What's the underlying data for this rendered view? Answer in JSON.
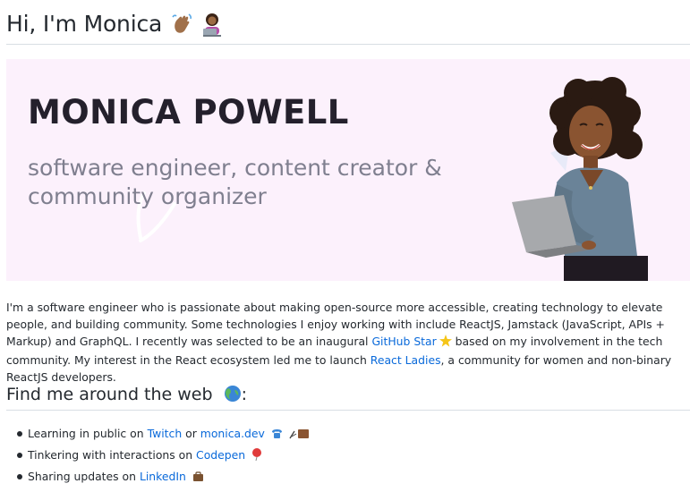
{
  "header": {
    "title": "Hi, I'm Monica",
    "emojis": [
      "waving-hand-icon",
      "technologist-icon"
    ]
  },
  "banner": {
    "name": "MONICA POWELL",
    "tagline": "software engineer, content creator & community organizer",
    "background": "#fcf1fc"
  },
  "intro": {
    "t1": "I'm a software engineer who is passionate about making open-source more accessible, creating technology to elevate people, and building community. Some technologies I enjoy working with include ReactJS, Jamstack (JavaScript, APIs + Markup) and GraphQL. I recently was selected to be an inaugural ",
    "link1": "GitHub Star",
    "t2": " based on my involvement in the tech community. My interest in the React ecosystem led me to launch ",
    "link2": "React Ladies",
    "t3": ", a community for women and non-binary ReactJS developers."
  },
  "section": {
    "title": "Find me around the web",
    "suffix": ":",
    "icon": "globe-icon"
  },
  "links": [
    {
      "prefix": "Learning in public on ",
      "link": "Twitch",
      "mid": " or ",
      "link2": "monica.dev",
      "icons": [
        "telephone-icon",
        "writing-hand-icon"
      ]
    },
    {
      "prefix": "Tinkering with interactions on ",
      "link": "Codepen",
      "icons": [
        "balloon-icon"
      ]
    },
    {
      "prefix": "Sharing updates on ",
      "link": "LinkedIn",
      "icons": [
        "briefcase-icon"
      ]
    }
  ],
  "colors": {
    "link": "#0969da",
    "text": "#24292f",
    "divider": "#d8dee4"
  }
}
